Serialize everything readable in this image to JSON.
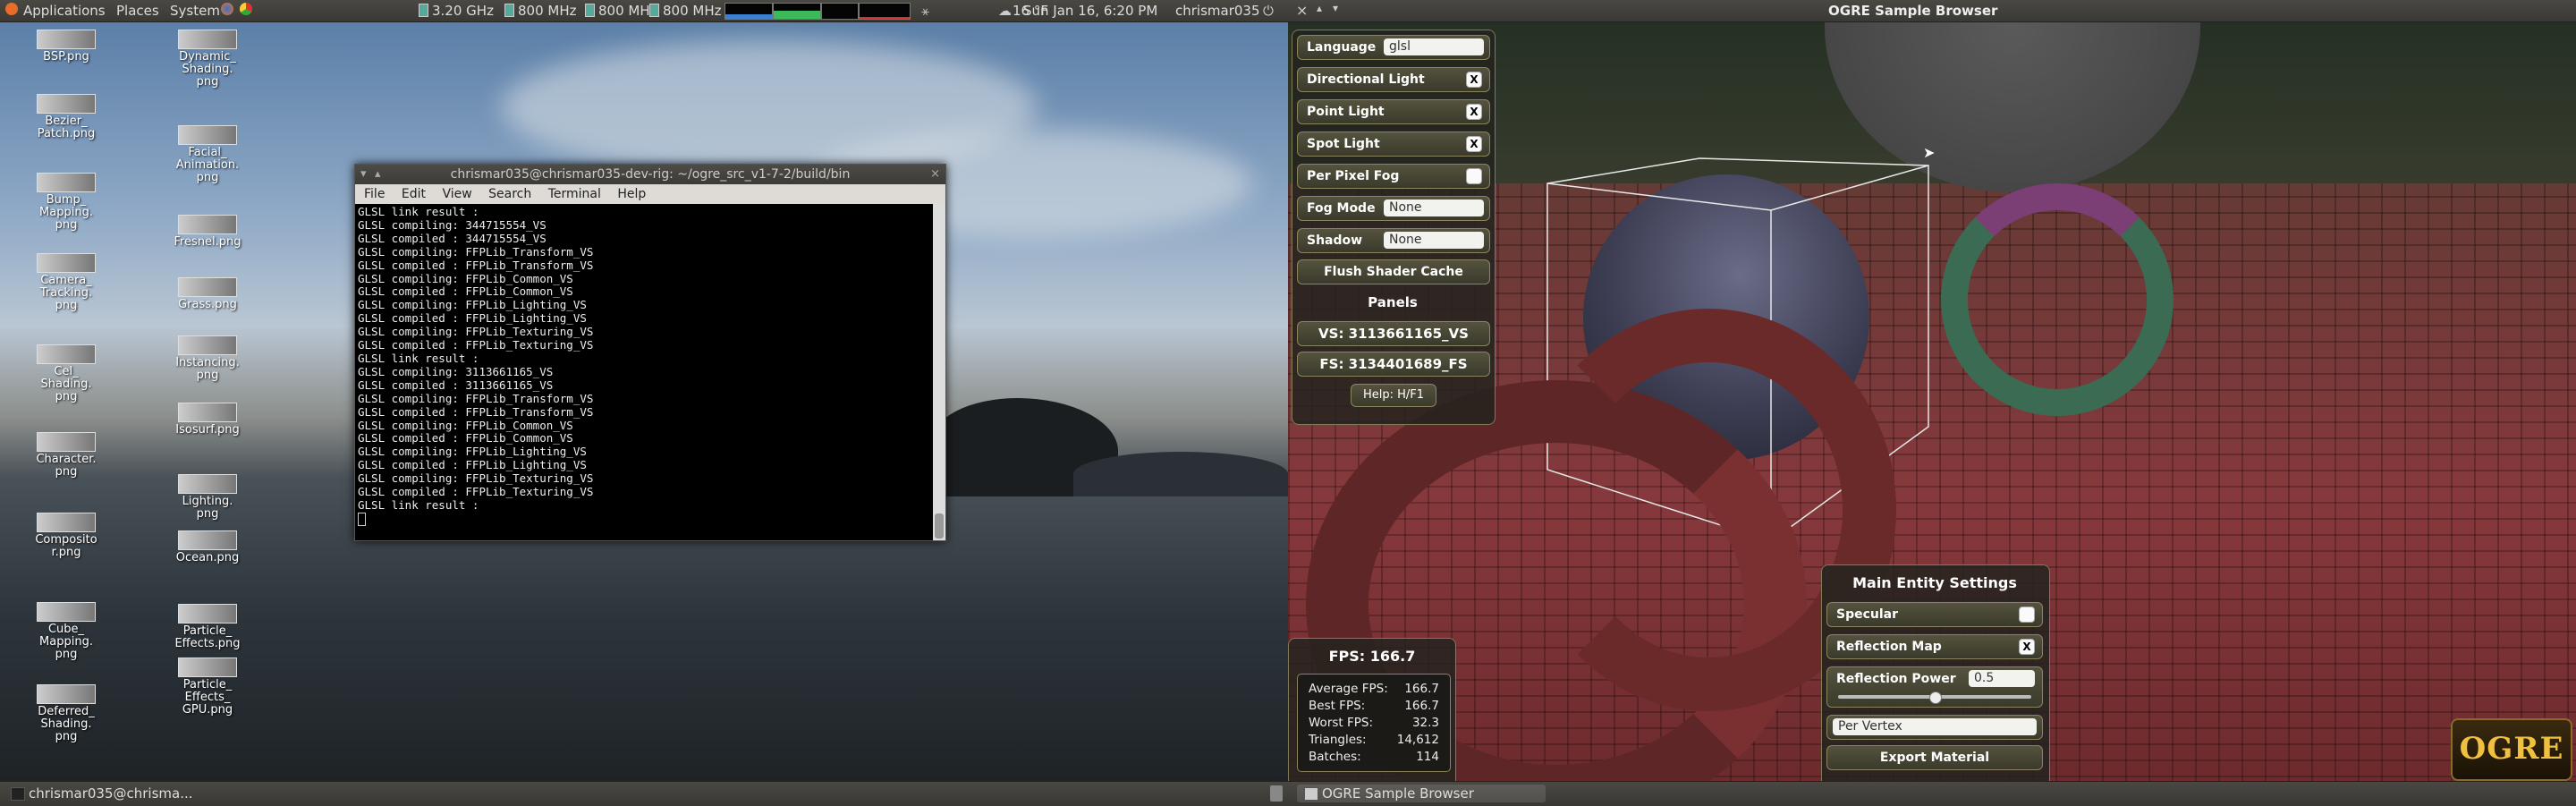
{
  "top_panel": {
    "menus": [
      "Applications",
      "Places",
      "System"
    ],
    "cpu": [
      "3.20 GHz",
      "800 MHz",
      "800 MHz",
      "800 MHz"
    ],
    "weather": "16 °F",
    "clock": "Sun Jan 16,  6:20 PM",
    "user": "chrismar035",
    "active_window_title": "OGRE Sample Browser"
  },
  "desktop_icons": [
    {
      "name": "BSP.png"
    },
    {
      "name": "Dynamic_\nShading.\npng"
    },
    {
      "name": "Bezier_\nPatch.png"
    },
    {
      "name": "Facial_\nAnimation.\npng"
    },
    {
      "name": "Bump_\nMapping.\npng"
    },
    {
      "name": "Fresnel.png"
    },
    {
      "name": "Camera_\nTracking.\npng"
    },
    {
      "name": "Grass.png"
    },
    {
      "name": "Cel_\nShading.\npng"
    },
    {
      "name": "Instancing.\npng"
    },
    {
      "name": "Character.\npng"
    },
    {
      "name": "Isosurf.png"
    },
    {
      "name": "Composito\nr.png"
    },
    {
      "name": "Lighting.\npng"
    },
    {
      "name": "Cube_\nMapping.\npng"
    },
    {
      "name": "Ocean.png"
    },
    {
      "name": "Deferred_\nShading.\npng"
    },
    {
      "name": "Particle_\nEffects.png"
    },
    {
      "name": "Particle_\nEffects_\nGPU.png"
    }
  ],
  "terminal": {
    "title": "chrismar035@chrismar035-dev-rig: ~/ogre_src_v1-7-2/build/bin",
    "menu": [
      "File",
      "Edit",
      "View",
      "Search",
      "Terminal",
      "Help"
    ],
    "lines": [
      "GLSL link result :",
      "GLSL compiling: 344715554_VS",
      "GLSL compiled : 344715554_VS",
      "GLSL compiling: FFPLib_Transform_VS",
      "GLSL compiled : FFPLib_Transform_VS",
      "GLSL compiling: FFPLib_Common_VS",
      "GLSL compiled : FFPLib_Common_VS",
      "GLSL compiling: FFPLib_Lighting_VS",
      "GLSL compiled : FFPLib_Lighting_VS",
      "GLSL compiling: FFPLib_Texturing_VS",
      "GLSL compiled : FFPLib_Texturing_VS",
      "GLSL link result :",
      "GLSL compiling: 3113661165_VS",
      "GLSL compiled : 3113661165_VS",
      "GLSL compiling: FFPLib_Transform_VS",
      "GLSL compiled : FFPLib_Transform_VS",
      "GLSL compiling: FFPLib_Common_VS",
      "GLSL compiled : FFPLib_Common_VS",
      "GLSL compiling: FFPLib_Lighting_VS",
      "GLSL compiled : FFPLib_Lighting_VS",
      "GLSL compiling: FFPLib_Texturing_VS",
      "GLSL compiled : FFPLib_Texturing_VS",
      "GLSL link result :"
    ]
  },
  "ogre": {
    "controls": [
      {
        "label": "Language",
        "value": "glsl"
      },
      {
        "label": "Directional Light",
        "check": "X"
      },
      {
        "label": "Point Light",
        "check": "X"
      },
      {
        "label": "Spot Light",
        "check": "X"
      },
      {
        "label": "Per Pixel Fog",
        "check": ""
      },
      {
        "label": "Fog Mode",
        "value": "None"
      },
      {
        "label": "Shadow",
        "value": "None"
      }
    ],
    "flush_button": "Flush Shader Cache",
    "panels_label": "Panels",
    "vs_label": "VS: 3113661165_VS",
    "fs_label": "FS: 3134401689_FS",
    "help_label": "Help:  H/F1",
    "fps_title": "FPS: 166.7",
    "stats": [
      {
        "label": "Average FPS:",
        "value": "166.7"
      },
      {
        "label": "Best FPS:",
        "value": "166.7"
      },
      {
        "label": "Worst FPS:",
        "value": "32.3"
      },
      {
        "label": "Triangles:",
        "value": "14,612"
      },
      {
        "label": "Batches:",
        "value": "114"
      }
    ],
    "entity_title": "Main Entity Settings",
    "specular_label": "Specular",
    "specular_check": "",
    "reflection_map_label": "Reflection Map",
    "reflection_map_check": "X",
    "reflection_power_label": "Reflection Power",
    "reflection_power_value": "0.5",
    "lighting_mode": "Per Vertex",
    "export_button": "Export Material",
    "logo_text": "OGRE"
  },
  "bottom_panel": {
    "task_terminal": "chrismar035@chrisma...",
    "task_ogre": "OGRE Sample Browser"
  }
}
